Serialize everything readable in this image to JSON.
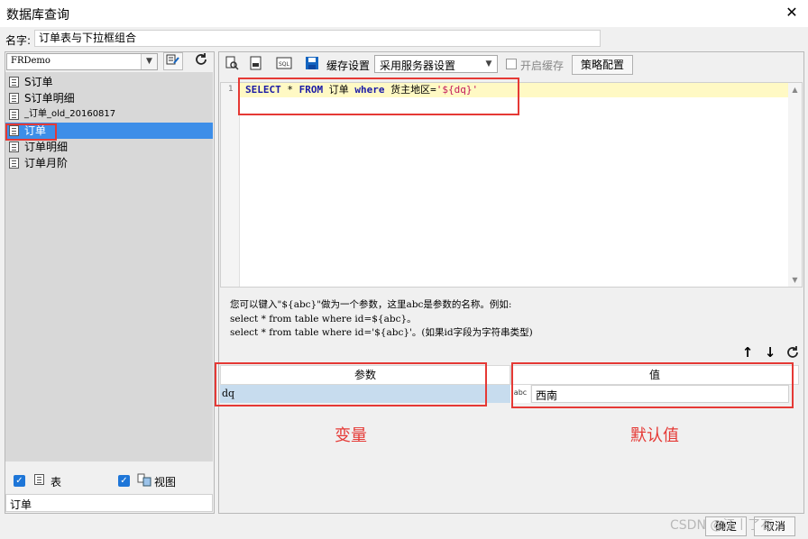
{
  "window": {
    "title": "数据库查询",
    "close_label": "✕"
  },
  "name_field": {
    "label": "名字:",
    "value": "订单表与下拉框组合"
  },
  "left_panel": {
    "datasource": "FRDemo",
    "tables": [
      {
        "label": "S订单",
        "small": false
      },
      {
        "label": "S订单明细",
        "small": false
      },
      {
        "label": "_订单_old_20160817",
        "small": true
      },
      {
        "label": "订单",
        "small": false,
        "selected": true
      },
      {
        "label": "订单明细",
        "small": false
      },
      {
        "label": "订单月阶",
        "small": false
      }
    ],
    "table_check_label": "表",
    "view_check_label": "视图",
    "filter_value": "订单"
  },
  "toolbar": {
    "cache_settings_label": "缓存设置",
    "cache_mode_value": "采用服务器设置",
    "enable_cache_label": "开启缓存",
    "strategy_label": "策略配置"
  },
  "editor": {
    "line_number": "1",
    "sql_select": "SELECT",
    "sql_star": " * ",
    "sql_from": "FROM",
    "sql_table": " 订单 ",
    "sql_where": "where",
    "sql_cond": " 货主地区=",
    "sql_param": "'${dq}'"
  },
  "hint": {
    "line1": "您可以键入\"${abc}\"做为一个参数，这里abc是参数的名称。例如:",
    "line2": "select * from table where id=${abc}。",
    "line3": "select * from table where id='${abc}'。(如果id字段为字符串类型)"
  },
  "param_table": {
    "header_param": "参数",
    "header_value": "值",
    "rows": [
      {
        "param": "dq",
        "type_icon": "abc",
        "value": "西南"
      }
    ]
  },
  "annotations": {
    "variable": "变量",
    "default_value": "默认值"
  },
  "footer": {
    "ok_label": "确定",
    "cancel_label": "取消",
    "watermark": "CSDN @江丨了石"
  },
  "colors": {
    "selection": "#3d8ee8",
    "highlight_box": "#e53935",
    "param_row": "#c7dcee"
  }
}
